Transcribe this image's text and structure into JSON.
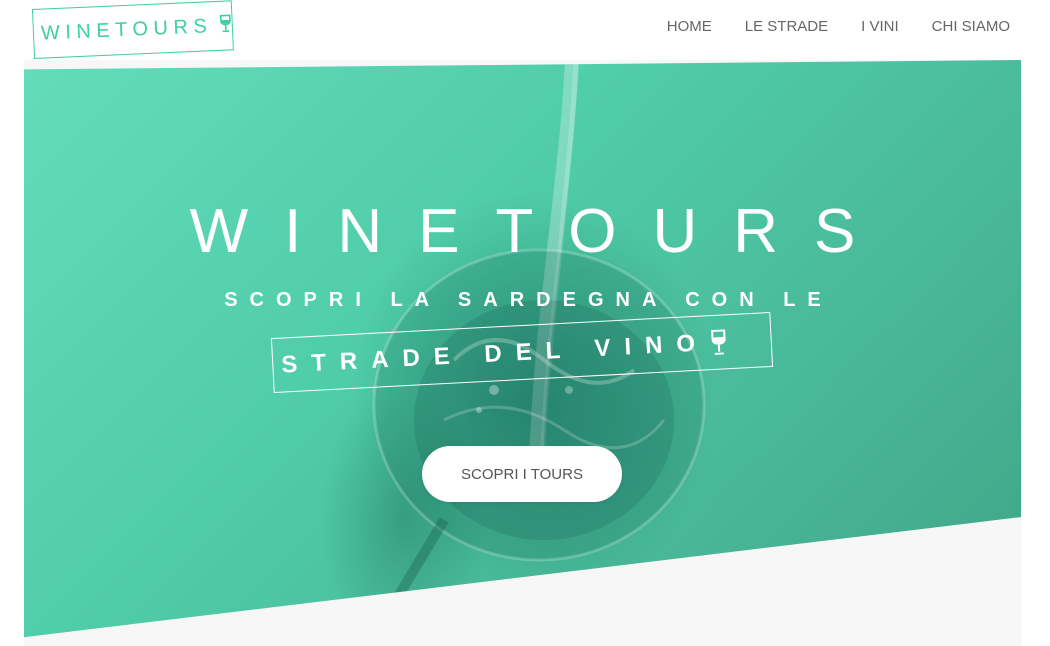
{
  "brand": {
    "logo_text": "WINETOURS",
    "logo_icon": "wine-glass-icon",
    "accent_color": "#3ecfa4"
  },
  "nav": {
    "items": [
      {
        "label": "HOME"
      },
      {
        "label": "LE STRADE"
      },
      {
        "label": "I VINI"
      },
      {
        "label": "CHI SIAMO"
      }
    ]
  },
  "hero": {
    "title": "WINETOURS",
    "subtitle": "SCOPRI LA SARDEGNA CON LE",
    "tagline": "STRADE DEL VINO",
    "tagline_icon": "wine-glass-icon",
    "cta_label": "SCOPRI I TOURS",
    "overlay_color": "#4fcca8"
  }
}
